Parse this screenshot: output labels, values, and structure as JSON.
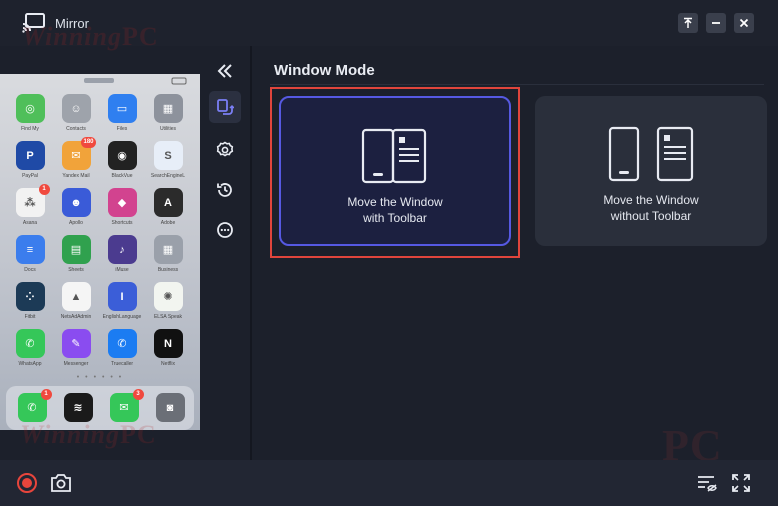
{
  "app": {
    "title": "Mirror",
    "icon": "mirror-cast-icon"
  },
  "window_controls": [
    {
      "name": "pin-icon"
    },
    {
      "name": "minimize-icon"
    },
    {
      "name": "close-icon"
    }
  ],
  "phone": {
    "apps": [
      {
        "label": "Find My",
        "color": "#4fbf5a",
        "glyph": "◎"
      },
      {
        "label": "Contacts",
        "color": "#9ea3ab",
        "glyph": "☺"
      },
      {
        "label": "Files",
        "color": "#2f7ff0",
        "glyph": "▭"
      },
      {
        "label": "Utilities",
        "color": "#8d929c",
        "glyph": "▦"
      },
      {
        "label": "PayPal",
        "color": "#1f4aa6",
        "glyph": "P"
      },
      {
        "label": "Yandex Mail",
        "color": "#f1a33a",
        "glyph": "✉",
        "badge": "180"
      },
      {
        "label": "BlackVue",
        "color": "#222222",
        "glyph": "◉"
      },
      {
        "label": "SearchEngineL",
        "color": "#e7eef8",
        "glyph": "S"
      },
      {
        "label": "Asana",
        "color": "#f2f2f2",
        "glyph": "⁂",
        "badge": "1"
      },
      {
        "label": "Apollo",
        "color": "#3a5bd8",
        "glyph": "☻"
      },
      {
        "label": "Shortcuts",
        "color": "#d2438f",
        "glyph": "◆"
      },
      {
        "label": "Adobe",
        "color": "#2b2b2b",
        "glyph": "A"
      },
      {
        "label": "Docs",
        "color": "#3b7ded",
        "glyph": "≡"
      },
      {
        "label": "Sheets",
        "color": "#30a14e",
        "glyph": "▤"
      },
      {
        "label": "iMuse",
        "color": "#4b3b8f",
        "glyph": "♪"
      },
      {
        "label": "Business",
        "color": "#9aa0aa",
        "glyph": "▦"
      },
      {
        "label": "Fitbit",
        "color": "#1c3a56",
        "glyph": "⁘"
      },
      {
        "label": "NetsAdAdmin",
        "color": "#f5f5f5",
        "glyph": "▲"
      },
      {
        "label": "EnglishLanguage",
        "color": "#3b5ed8",
        "glyph": "I"
      },
      {
        "label": "ELSA Speak",
        "color": "#f2f5f0",
        "glyph": "✺"
      },
      {
        "label": "WhatsApp",
        "color": "#35c759",
        "glyph": "✆"
      },
      {
        "label": "Messenger",
        "color": "#8a4cf0",
        "glyph": "✎"
      },
      {
        "label": "Truecaller",
        "color": "#1b7cf2",
        "glyph": "✆"
      },
      {
        "label": "Netflix",
        "color": "#111111",
        "glyph": "N"
      }
    ],
    "dock": [
      {
        "label": "Phone",
        "color": "#35c759",
        "glyph": "✆",
        "badge": "1"
      },
      {
        "label": "Spotify",
        "color": "#1a1a1a",
        "glyph": "≋"
      },
      {
        "label": "Messages",
        "color": "#35c759",
        "glyph": "✉",
        "badge": "3"
      },
      {
        "label": "Camera",
        "color": "#6b6f77",
        "glyph": "◙"
      }
    ],
    "page_dots": "• • • • • •"
  },
  "sidebar": {
    "items": [
      {
        "name": "collapse-icon"
      },
      {
        "name": "window-mode-icon",
        "active": true
      },
      {
        "name": "settings-icon"
      },
      {
        "name": "history-icon"
      },
      {
        "name": "more-icon"
      }
    ]
  },
  "main": {
    "title": "Window Mode",
    "modes": [
      {
        "label_line1": "Move the Window",
        "label_line2": "with Toolbar",
        "selected": true
      },
      {
        "label_line1": "Move the Window",
        "label_line2": "without Toolbar",
        "selected": false
      }
    ]
  },
  "bottom": {
    "left": [
      {
        "name": "record-icon"
      },
      {
        "name": "screenshot-icon"
      }
    ],
    "right": [
      {
        "name": "subtitle-toggle-icon"
      },
      {
        "name": "fullscreen-icon"
      }
    ]
  },
  "colors": {
    "accent": "#5659e2",
    "highlight": "#e0453c",
    "record": "#e8453c"
  }
}
